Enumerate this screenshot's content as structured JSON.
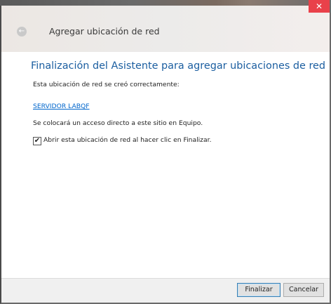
{
  "window": {
    "title": "Agregar ubicación de red",
    "close_glyph": "✕",
    "back_glyph": "←"
  },
  "content": {
    "heading": "Finalización del Asistente para agregar ubicaciones de red",
    "created_msg": "Esta ubicación de red se creó correctamente:",
    "location_link": "SERVIDOR LABQF",
    "shortcut_msg": "Se colocará un acceso directo a este sitio en Equipo.",
    "open_checkbox": {
      "label": "Abrir esta ubicación de red al hacer clic en Finalizar.",
      "checked": true,
      "glyph": "✔"
    }
  },
  "footer": {
    "finish_label": "Finalizar",
    "cancel_label": "Cancelar"
  },
  "colors": {
    "heading": "#1b5ea0",
    "link": "#0066cc",
    "close": "#e9414a"
  }
}
